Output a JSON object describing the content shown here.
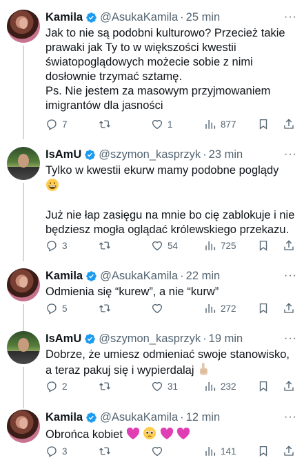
{
  "tweets": [
    {
      "author": "Kamila",
      "handle": "@AsukaKamila",
      "sep": "·",
      "time": "25 min",
      "lines": [
        "Jak to nie są podobni kulturowo? Przecież takie",
        "prawaki jak Ty to w większości kwestii",
        "światopoglądowych możecie sobie z nimi",
        "dosłownie trzymać sztamę.",
        "Ps. Nie jestem za masowym przyjmowaniem",
        "imigrantów dla jasności"
      ],
      "replies": "7",
      "retweets": "",
      "likes": "1",
      "views": "877"
    },
    {
      "author": "IsAmU",
      "handle": "@szymon_kasprzyk",
      "sep": "·",
      "time": "23 min",
      "lines": [
        "Tylko w kwestii ekurw mamy podobne poglądy",
        "",
        "",
        "Już nie łap zasięgu na mnie bo cię zablokuje i nie",
        "będziesz mogła oglądać królewskiego przekazu."
      ],
      "replies": "3",
      "retweets": "",
      "likes": "54",
      "views": "725"
    },
    {
      "author": "Kamila",
      "handle": "@AsukaKamila",
      "sep": "·",
      "time": "22 min",
      "lines": [
        "Odmienia się “kurew”, a nie “kurw”"
      ],
      "replies": "5",
      "retweets": "",
      "likes": "",
      "views": "272"
    },
    {
      "author": "IsAmU",
      "handle": "@szymon_kasprzyk",
      "sep": "·",
      "time": "19 min",
      "lines": [
        "Dobrze, że umiesz odmieniać swoje stanowisko,",
        "a teraz pakuj się i wypierdalaj"
      ],
      "replies": "2",
      "retweets": "",
      "likes": "31",
      "views": "232"
    },
    {
      "author": "Kamila",
      "handle": "@AsukaKamila",
      "sep": "·",
      "time": "12 min",
      "lines": [
        "Obrońca kobiet"
      ],
      "replies": "3",
      "retweets": "",
      "likes": "",
      "views": "141"
    }
  ],
  "icons": {
    "verified": "verified-badge-icon",
    "more": "more-icon",
    "reply": "reply-icon",
    "retweet": "retweet-icon",
    "like": "heart-icon",
    "views": "views-icon",
    "bookmark": "bookmark-icon",
    "share": "share-icon"
  },
  "colors": {
    "verified": "#1d9bf0",
    "text": "#0f1419",
    "secondary": "#536471",
    "thread_line": "#cfd9de",
    "heart_emoji": "#e03fb3"
  },
  "more_glyph": "···"
}
